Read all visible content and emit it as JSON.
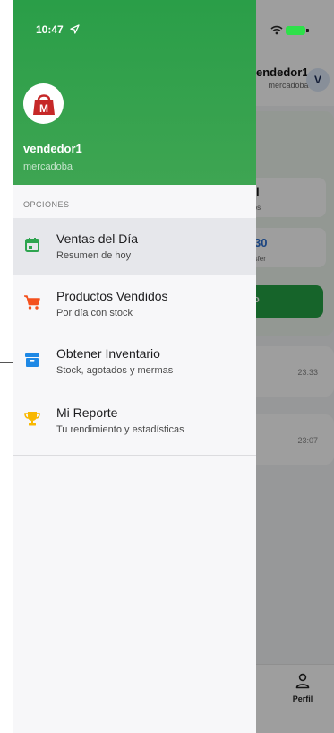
{
  "status_bar": {
    "time": "10:47"
  },
  "background_app": {
    "user_name": "endedor1",
    "user_sub": "mercadoba",
    "avatar_letter": "V",
    "stat_1": {
      "value": "l",
      "label": "uctos"
    },
    "stat_2": {
      "value": "30",
      "label": "ransfer"
    },
    "button_label": "o",
    "transactions": [
      {
        "time": "23:33"
      },
      {
        "time": "23:07"
      }
    ],
    "bottom_nav": {
      "perfil_label": "Perfil"
    }
  },
  "drawer": {
    "logo_letter": "M",
    "user_name": "vendedor1",
    "user_sub": "mercadoba",
    "section_label": "OPCIONES",
    "items": [
      {
        "title": "Ventas del Día",
        "subtitle": "Resumen de hoy",
        "icon": "calendar-icon",
        "color": "#2ea44f"
      },
      {
        "title": "Productos Vendidos",
        "subtitle": "Por día con stock",
        "icon": "cart-icon",
        "color": "#f4511e"
      },
      {
        "title": "Obtener Inventario",
        "subtitle": "Stock, agotados y mermas",
        "icon": "archive-icon",
        "color": "#1e88e5"
      },
      {
        "title": "Mi Reporte",
        "subtitle": "Tu rendimiento y estadísticas",
        "icon": "trophy-icon",
        "color": "#f9b800"
      }
    ]
  },
  "colors": {
    "brand_green": "#2a9e48",
    "logo_red": "#c62828"
  }
}
